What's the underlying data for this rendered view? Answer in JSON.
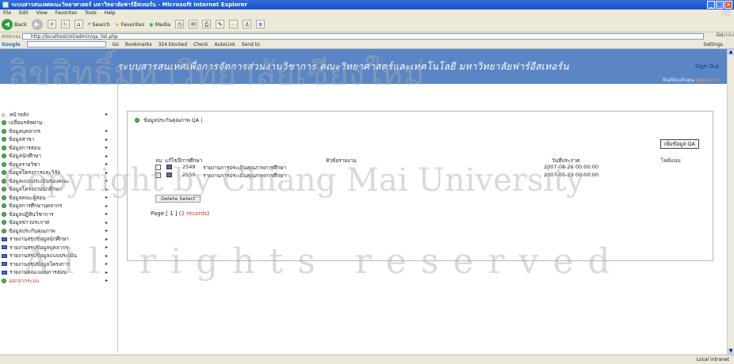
{
  "window": {
    "title": "ระบบสารสนเทศคณะวิทยาศาสตร์ มหาวิทยาลัยฟาร์อีสเทอร์น - Microsoft Internet Explorer"
  },
  "menu": [
    "File",
    "Edit",
    "View",
    "Favorites",
    "Tools",
    "Help"
  ],
  "toolbar": {
    "back": "Back",
    "search": "Search",
    "favorites": "Favorites",
    "media": "Media"
  },
  "address": {
    "label": "Address",
    "url": "http://localhost/oil/admin/qa_list.php",
    "go": "Go",
    "links": "Links"
  },
  "google": {
    "label": "Google",
    "go": "Go",
    "bookmarks": "Bookmarks",
    "blocked": "324 blocked",
    "check": "Check",
    "autolink": "AutoLink",
    "sendto": "Send to",
    "settings": "Settings"
  },
  "banner": {
    "title": "ระบบสารสนเทศเพื่อการจัดการส่วนงานวิชาการ คณะวิทยาศาสตร์และเทคโนโลยี มหาวิทยาลัยฟาร์อีสเทอร์น",
    "signout": "Sign Out",
    "welcome": "ยินดีต้อนรับคุณ",
    "user": "ผู้ดูแลระบบ"
  },
  "sidebar": [
    {
      "label": "หน้าหลัก",
      "icon": "home-icon",
      "arrow": true
    },
    {
      "label": "เปลี่ยนรหัสผ่าน",
      "icon": "circle-icon",
      "arrow": false
    },
    {
      "label": "ข้อมูลบุคลากร",
      "icon": "circle-icon",
      "arrow": true
    },
    {
      "label": "ข้อมูลสาขา",
      "icon": "circle-icon",
      "arrow": true
    },
    {
      "label": "ข้อมูลการสอน",
      "icon": "circle-icon",
      "arrow": true
    },
    {
      "label": "ข้อมูลนักศึกษา",
      "icon": "circle-icon",
      "arrow": true
    },
    {
      "label": "ข้อมูลรายวิชา",
      "icon": "circle-icon",
      "arrow": true
    },
    {
      "label": "ข้อมูลโครงการและวิจัย",
      "icon": "circle-icon",
      "arrow": true
    },
    {
      "label": "ข้อมูลแบบประเมินของคณะ",
      "icon": "circle-icon",
      "arrow": true
    },
    {
      "label": "ข้อมูลโครงงานนักศึกษา",
      "icon": "circle-icon",
      "arrow": true
    },
    {
      "label": "ข้อมูลคณะผู้สอน",
      "icon": "circle-icon",
      "arrow": true
    },
    {
      "label": "ข้อมูลการศึกษาบุคลากร",
      "icon": "circle-icon",
      "arrow": true
    },
    {
      "label": "ข้อมูลปฏิทินวิชาการ",
      "icon": "circle-icon",
      "arrow": true
    },
    {
      "label": "ข้อมูลข่าวประกาศ",
      "icon": "circle-icon",
      "arrow": true
    },
    {
      "label": "ข้อมูลประกันคุณภาพ",
      "icon": "circle-icon",
      "arrow": true
    },
    {
      "label": "รายงานสรุปข้อมูลนักศึกษา",
      "icon": "book-icon",
      "arrow": true
    },
    {
      "label": "รายงานสรุปข้อมูลบุคลากร",
      "icon": "book-icon",
      "arrow": true
    },
    {
      "label": "รายงานสรุปข้อมูลแบบประเมิน",
      "icon": "book-icon",
      "arrow": true
    },
    {
      "label": "รายงานสรุปข้อมูลโครงการ",
      "icon": "book-icon",
      "arrow": true
    },
    {
      "label": "รายงานคณะแผนการสอน",
      "icon": "book-icon",
      "arrow": true
    },
    {
      "label": "ออกจากระบบ",
      "icon": "circle-icon",
      "arrow": true,
      "color": "#c0392b"
    }
  ],
  "main": {
    "crumb": "ข้อมูลประกันคุณภาพ QA |",
    "add_button": "เพิ่มข้อมูล QA",
    "headers": {
      "del": "ลบ",
      "edit": "แก้ไข",
      "year": "ปีการศึกษา",
      "topic": "หัวข้อรายงาน",
      "date": "วันที่ประกาศ",
      "file": "ไฟล์แนบ"
    },
    "rows": [
      {
        "year": "2549",
        "topic": "รายงานการประเมินคุณภาพการศึกษา",
        "date": "2007-08-26 00:00:00"
      },
      {
        "year": "2550",
        "topic": "รายงานการประเมินคุณภาพการศึกษา",
        "date": "2007-05-23 00:00:00"
      }
    ],
    "delete_button": "Delete Select",
    "pager_prefix": "Page [ 1 ] (",
    "pager_count": "2 records",
    "pager_suffix": ")"
  },
  "status": {
    "zone": "Local intranet"
  },
  "watermark": {
    "line1": "ลิขสิทธิ์มหาวิทยาลัยเชียงใหม่",
    "line2": "Copyright by Chiang Mai University",
    "line3": "All rights reserved"
  }
}
